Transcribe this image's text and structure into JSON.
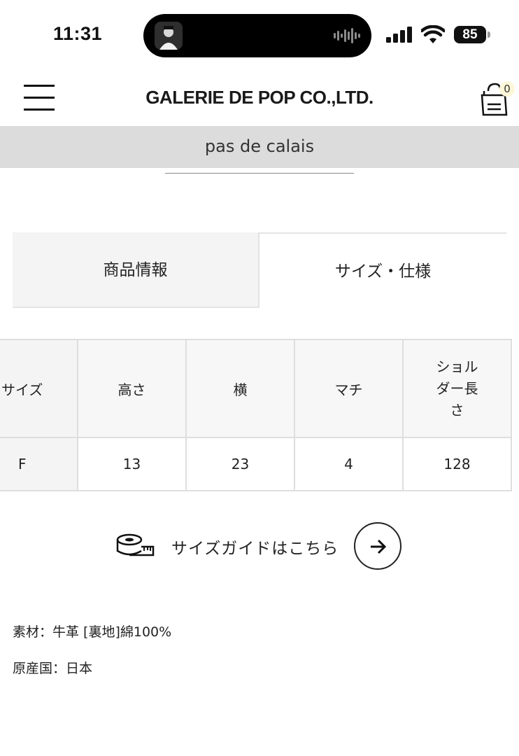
{
  "status_bar": {
    "time": "11:31",
    "battery": "85",
    "icons": [
      "profile-thumbnail-icon",
      "audio-waveform-icon",
      "cellular-signal-icon",
      "wifi-icon",
      "battery-icon"
    ]
  },
  "header": {
    "brand": "GALERIE DE POP CO.,LTD.",
    "cart_count": "0",
    "icons": [
      "hamburger-menu-icon",
      "shopping-bag-icon"
    ]
  },
  "category": {
    "label": "pas de calais"
  },
  "tabs": [
    {
      "label": "商品情報",
      "active": false
    },
    {
      "label": "サイズ・仕様",
      "active": true
    }
  ],
  "size_table": {
    "headers": [
      "サイズ",
      "高さ",
      "横",
      "マチ",
      "ショルダー長さ"
    ],
    "rows": [
      [
        "F",
        "13",
        "23",
        "4",
        "128"
      ]
    ]
  },
  "size_guide": {
    "label": "サイズガイドはこちら",
    "icons": [
      "measuring-tape-icon",
      "arrow-right-icon"
    ]
  },
  "specs": {
    "material": "素材：牛革 [裏地]綿100%",
    "origin": "原産国：日本"
  },
  "colors": {
    "band_bg": "#dcdcdc",
    "tab_inactive_bg": "#f4f4f4",
    "table_header_bg": "#f7f7f7",
    "border": "#dedede",
    "cart_badge_bg": "#fdf6d8"
  }
}
